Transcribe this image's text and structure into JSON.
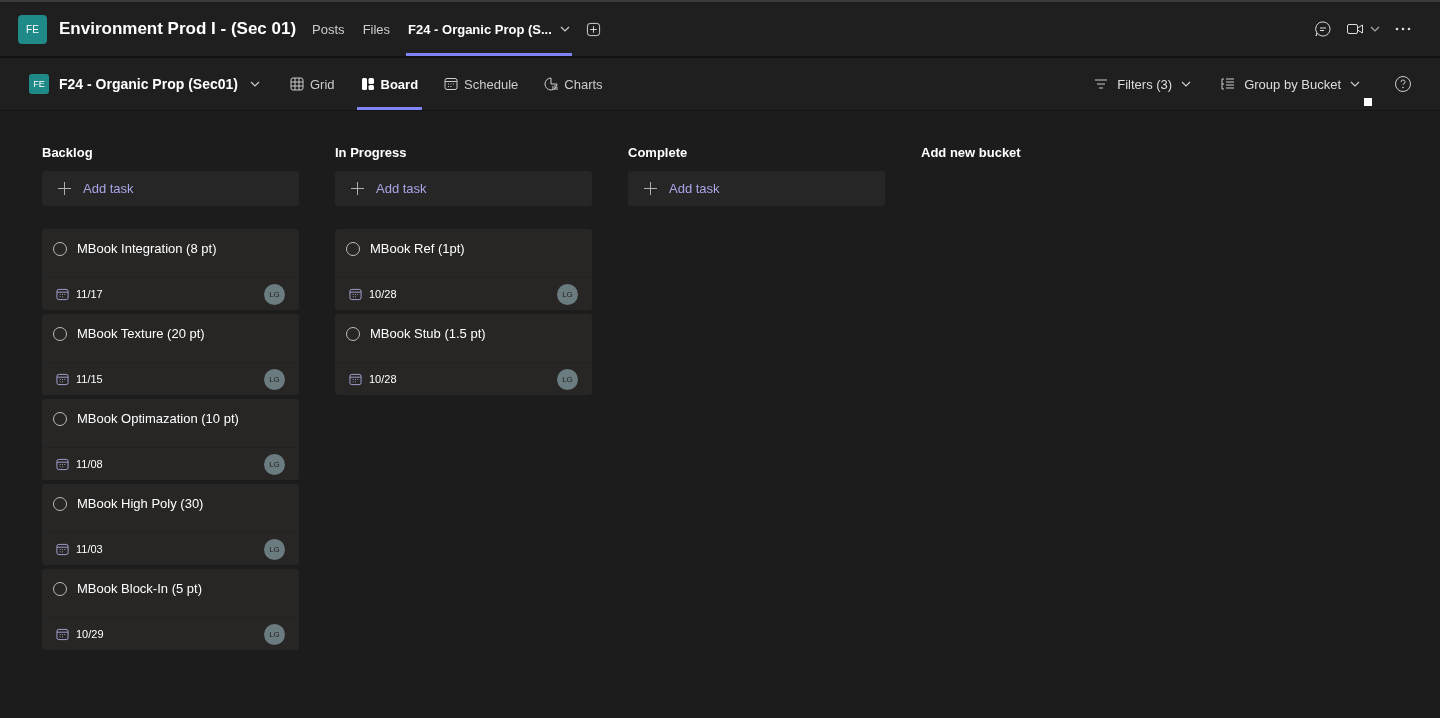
{
  "header": {
    "team_avatar": "FE",
    "team_name": "Environment Prod I - (Sec 01)",
    "tabs": [
      {
        "label": "Posts",
        "selected": false,
        "dropdown": false
      },
      {
        "label": "Files",
        "selected": false,
        "dropdown": false
      },
      {
        "label": "F24 - Organic Prop (S...",
        "selected": true,
        "dropdown": true
      }
    ]
  },
  "toolbar": {
    "plan_avatar": "FE",
    "plan_name": "F24 - Organic Prop (Sec01)",
    "views": [
      {
        "label": "Grid",
        "kind": "grid",
        "selected": false
      },
      {
        "label": "Board",
        "kind": "board",
        "selected": true
      },
      {
        "label": "Schedule",
        "kind": "schedule",
        "selected": false
      },
      {
        "label": "Charts",
        "kind": "charts",
        "selected": false
      }
    ],
    "filters": "Filters (3)",
    "group_by": "Group by Bucket"
  },
  "buckets": [
    {
      "name": "Backlog",
      "add_label": "Add task",
      "tasks": [
        {
          "title": "MBook Integration (8 pt)",
          "due": "11/17",
          "assignee": "LG"
        },
        {
          "title": "MBook Texture (20 pt)",
          "due": "11/15",
          "assignee": "LG"
        },
        {
          "title": "MBook Optimazation (10 pt)",
          "due": "11/08",
          "assignee": "LG"
        },
        {
          "title": "MBook High Poly (30)",
          "due": "11/03",
          "assignee": "LG"
        },
        {
          "title": "MBook Block-In (5 pt)",
          "due": "10/29",
          "assignee": "LG"
        }
      ]
    },
    {
      "name": "In Progress",
      "add_label": "Add task",
      "tasks": [
        {
          "title": "MBook Ref (1pt)",
          "due": "10/28",
          "assignee": "LG"
        },
        {
          "title": "MBook Stub (1.5 pt)",
          "due": "10/28",
          "assignee": "LG"
        }
      ]
    },
    {
      "name": "Complete",
      "add_label": "Add task"
    }
  ],
  "add_bucket": "Add new bucket"
}
